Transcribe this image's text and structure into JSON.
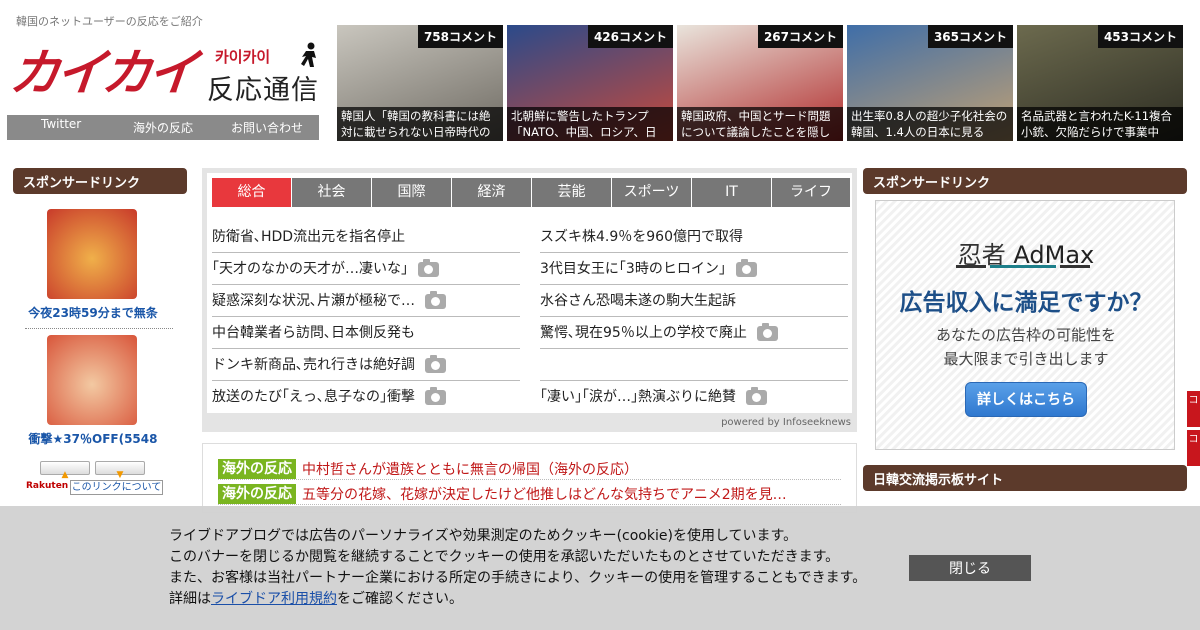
{
  "header": {
    "tagline": "韓国のネットユーザーの反応をご紹介",
    "logo_main": "カイカイ",
    "logo_kana": "카이카이",
    "logo_sub": "反応通信",
    "nav": [
      "Twitter",
      "海外の反応",
      "お問い合わせ"
    ]
  },
  "thumbnails": [
    {
      "count": "758コメント",
      "caption": "韓国人「韓国の教科書には絶対に載せられない日帝時代の",
      "colors": [
        "#c9c6be",
        "#6e6a62"
      ]
    },
    {
      "count": "426コメント",
      "caption": "北朝鮮に警告したトランプ「NATO、中国、ロシア、日",
      "colors": [
        "#2b4a8a",
        "#c94a3a"
      ]
    },
    {
      "count": "267コメント",
      "caption": "韓国政府、中国とサード問題について議論したことを隠し",
      "colors": [
        "#e9e4dc",
        "#b02a2a"
      ]
    },
    {
      "count": "365コメント",
      "caption": "出生率0.8人の超少子化社会の韓国、1.4人の日本に見る",
      "colors": [
        "#3f6ea8",
        "#c2a173"
      ]
    },
    {
      "count": "453コメント",
      "caption": "名品武器と言われたK-11複合小銃、欠陥だらけで事業中",
      "colors": [
        "#6c6a4e",
        "#2c2c22"
      ]
    }
  ],
  "left_sidebar": {
    "title": "スポンサードリンク",
    "products": [
      {
        "label": "今夜23時59分まで無条",
        "colors": [
          "#c83a2a",
          "#f0b04a"
        ]
      },
      {
        "label": "衝撃★37％OFF(5548",
        "colors": [
          "#d8553a",
          "#f3c9a2"
        ]
      }
    ],
    "up_arrow": "▲",
    "down_arrow": "▼",
    "rakuten": "Rakuten",
    "about_link": "このリンクについて"
  },
  "news": {
    "tabs": [
      "総合",
      "社会",
      "国際",
      "経済",
      "芸能",
      "スポーツ",
      "IT",
      "ライフ"
    ],
    "active_tab": "総合",
    "left_items": [
      {
        "text": "防衛省､HDD流出元を指名停止",
        "camera": false
      },
      {
        "text": "｢天才のなかの天才が…凄いな｣",
        "camera": true
      },
      {
        "text": "疑惑深刻な状況､片瀬が極秘で…",
        "camera": true
      },
      {
        "text": "中台韓業者ら訪問､日本側反発も",
        "camera": false
      },
      {
        "text": "ドンキ新商品､売れ行きは絶好調",
        "camera": true
      },
      {
        "text": "放送のたび｢えっ､息子なの｣衝撃",
        "camera": true
      }
    ],
    "right_items": [
      {
        "text": "スズキ株4.9％を960億円で取得",
        "camera": false
      },
      {
        "text": "3代目女王に｢3時のヒロイン｣",
        "camera": true
      },
      {
        "text": "水谷さん恐喝未遂の駒大生起訴",
        "camera": false
      },
      {
        "text": "驚愕､現在95％以上の学校で廃止",
        "camera": true
      },
      {
        "text": "",
        "camera": false
      },
      {
        "text": "｢凄い｣｢涙が…｣熱演ぶりに絶賛",
        "camera": true
      }
    ],
    "powered_by": "powered by Infoseeknews"
  },
  "feed": [
    {
      "tag": "海外の反応",
      "title": "中村哲さんが遺族とともに無言の帰国（海外の反応）"
    },
    {
      "tag": "海外の反応",
      "title": "五等分の花嫁、花嫁が決定したけど他推しはどんな気持ちでアニメ2期を見…"
    }
  ],
  "right_sidebar": {
    "title": "スポンサードリンク",
    "ad": {
      "brand_prefix": "忍者",
      "brand_name": "AdMax",
      "headline": "広告収入に満足ですか？",
      "copy_line1": "あなたの広告枠の可能性を",
      "copy_line2": "最大限まで引き出します",
      "button": "詳しくはこちら"
    },
    "section2_title": "日韓交流掲示板サイト",
    "edge_tabs": [
      "コ",
      "コ"
    ]
  },
  "cookie_banner": {
    "line1": "ライブドアブログでは広告のパーソナライズや効果測定のためクッキー(cookie)を使用しています。",
    "line2": "このバナーを閉じるか閲覧を継続することでクッキーの使用を承認いただいたものとさせていただきます。",
    "line3": "また、お客様は当社パートナー企業における所定の手続きにより、クッキーの使用を管理することもできます。",
    "line4_prefix": "詳細は",
    "line4_link": "ライブドア利用規約",
    "line4_suffix": "をご確認ください。",
    "close_button": "閉じる"
  },
  "colors": {
    "brand_red": "#c6192b",
    "sidebar_head": "#5c3a2b",
    "active_tab": "#e8383d",
    "feed_tag": "#7ab520"
  }
}
